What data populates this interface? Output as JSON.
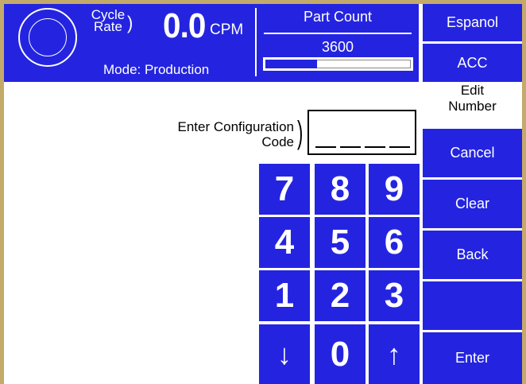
{
  "header": {
    "cycle_label_1": "Cycle",
    "cycle_label_2": "Rate",
    "rate_value": "0.0",
    "rate_unit": "CPM",
    "mode": "Mode: Production",
    "part_count_title": "Part Count",
    "part_count_value": "3600",
    "part_count_progress": 0.35
  },
  "side": {
    "language_label": "Espanol",
    "acc_label": "ACC",
    "edit_title_1": "Edit",
    "edit_title_2": "Number",
    "cancel_label": "Cancel",
    "clear_label": "Clear",
    "back_label": "Back",
    "blank_label": "",
    "enter_label": "Enter"
  },
  "form": {
    "prompt_line_1": "Enter Configuration",
    "prompt_line_2": "Code",
    "code_value": ""
  },
  "keypad": {
    "k7": "7",
    "k8": "8",
    "k9": "9",
    "k4": "4",
    "k5": "5",
    "k6": "6",
    "k1": "1",
    "k2": "2",
    "k3": "3",
    "down": "↓",
    "k0": "0",
    "up": "↑"
  },
  "colors": {
    "panel_blue": "#2424e0",
    "frame_gold": "#c3aa6a"
  }
}
